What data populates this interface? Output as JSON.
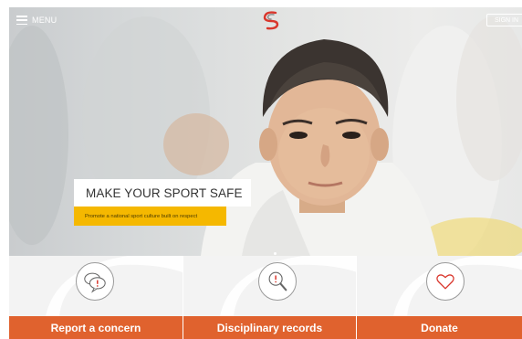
{
  "header": {
    "menu_label": "MENU",
    "signin_label": "SIGN IN",
    "logo_icon": "safesport-logo-icon",
    "menu_icon": "hamburger-menu-icon"
  },
  "hero": {
    "title": "MAKE YOUR SPORT SAFE",
    "subtitle": "Promote a national sport culture built on respect"
  },
  "actions": [
    {
      "label": "Report a concern",
      "icon": "speech-bubbles-alert-icon"
    },
    {
      "label": "Disciplinary records",
      "icon": "magnifier-alert-icon"
    },
    {
      "label": "Donate",
      "icon": "heart-icon"
    }
  ],
  "colors": {
    "action_bar": "#e0622e",
    "subtitle_bg": "#f5b800",
    "logo_red": "#d9362c",
    "logo_grey": "#8a8a8a",
    "icon_red": "#d9362c"
  }
}
